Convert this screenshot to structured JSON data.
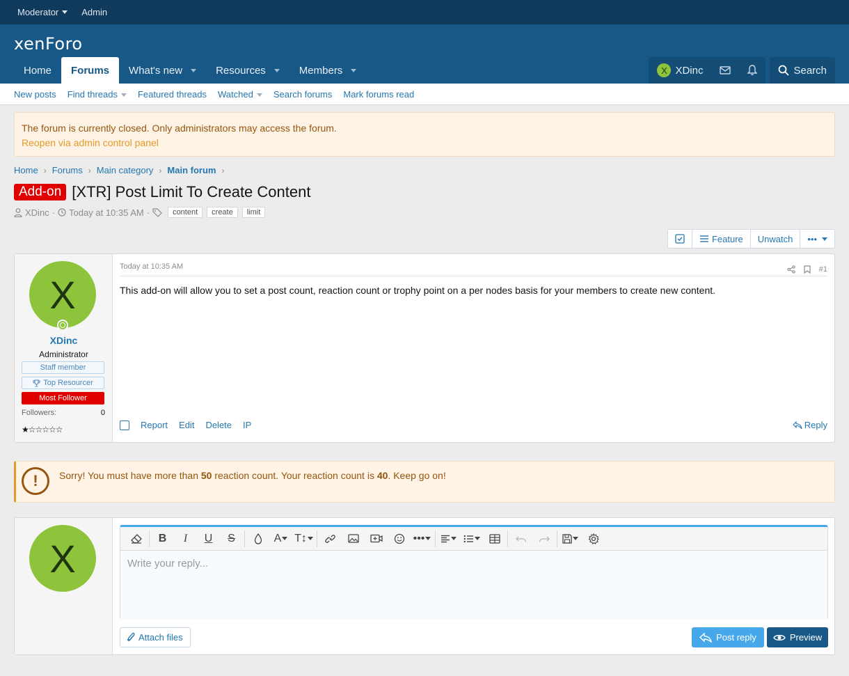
{
  "staffbar": {
    "moderator": "Moderator",
    "admin": "Admin"
  },
  "header": {
    "logo": "xenForo"
  },
  "nav": {
    "tabs": [
      {
        "label": "Home",
        "active": false
      },
      {
        "label": "Forums",
        "active": true
      },
      {
        "label": "What's new",
        "active": false
      },
      {
        "label": "Resources",
        "active": false
      },
      {
        "label": "Members",
        "active": false
      }
    ],
    "user": "XDinc",
    "user_initial": "X",
    "search": "Search"
  },
  "subnav": [
    "New posts",
    "Find threads",
    "Featured threads",
    "Watched",
    "Search forums",
    "Mark forums read"
  ],
  "notice": {
    "text": "The forum is currently closed. Only administrators may access the forum.",
    "link": "Reopen via admin control panel"
  },
  "breadcrumb": [
    "Home",
    "Forums",
    "Main category",
    "Main forum"
  ],
  "thread": {
    "prefix": "Add-on",
    "title": "[XTR] Post Limit To Create Content",
    "author": "XDinc",
    "date": "Today at 10:35 AM",
    "tags": [
      "content",
      "create",
      "limit"
    ]
  },
  "buttons": {
    "feature": "Feature",
    "unwatch": "Unwatch",
    "more": "•••"
  },
  "post": {
    "avatar_initial": "X",
    "username": "XDinc",
    "user_title": "Administrator",
    "banners": [
      "Staff member",
      "Top Resourcer",
      "Most Follower"
    ],
    "followers_label": "Followers:",
    "followers_value": "0",
    "stars": "★☆☆☆☆☆",
    "date": "Today at 10:35 AM",
    "number": "#1",
    "body": "This add-on will allow you to set a post count, reaction count or trophy point on a per nodes basis for your members to create new content.",
    "actions": [
      "Report",
      "Edit",
      "Delete",
      "IP"
    ],
    "reply": "Reply"
  },
  "warning": {
    "part1": "Sorry! You must have more than ",
    "required": "50",
    "part2": " reaction count. Your reaction count is ",
    "current": "40",
    "part3": ". Keep go on!"
  },
  "reply_box": {
    "avatar_initial": "X",
    "placeholder": "Write your reply...",
    "attach": "Attach files",
    "post_reply": "Post reply",
    "preview": "Preview"
  },
  "colors": {
    "header": "#185886",
    "staffbar": "#0f3a5c",
    "accent": "#2577b1",
    "prefix": "#e10000",
    "avatar": "#8ec43c",
    "notice_bg": "#fef3e5"
  }
}
